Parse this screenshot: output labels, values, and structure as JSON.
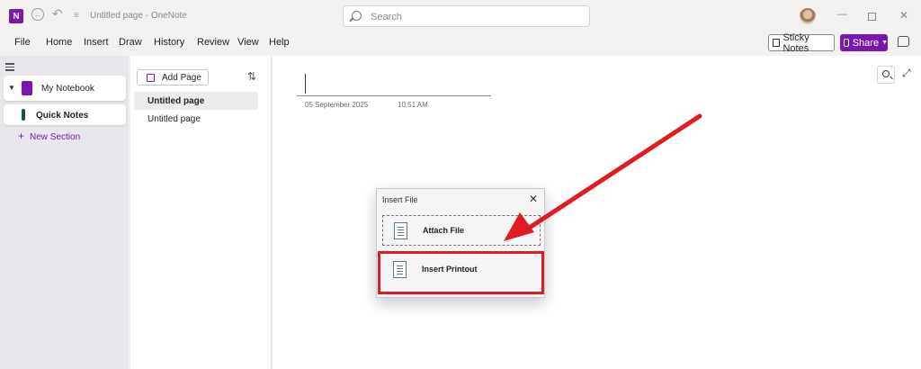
{
  "app": {
    "title": "Untitled page - OneNote",
    "logo_letter": "N",
    "search_placeholder": "Search"
  },
  "menu": {
    "items": [
      "File",
      "Home",
      "Insert",
      "Draw",
      "History",
      "Review",
      "View",
      "Help"
    ],
    "sticky_notes": "Sticky Notes",
    "share": "Share"
  },
  "sidebar": {
    "notebook": "My Notebook",
    "section": "Quick Notes",
    "new_section": "New Section"
  },
  "pages": {
    "add_page": "Add Page",
    "items": [
      "Untitled page",
      "Untitled page"
    ]
  },
  "canvas": {
    "date": "05 September 2025",
    "time": "10:51 AM"
  },
  "dialog": {
    "title": "Insert File",
    "attach_file": "Attach File",
    "insert_printout": "Insert Printout"
  },
  "colors": {
    "accent": "#7719aa",
    "highlight": "#e01b24"
  }
}
